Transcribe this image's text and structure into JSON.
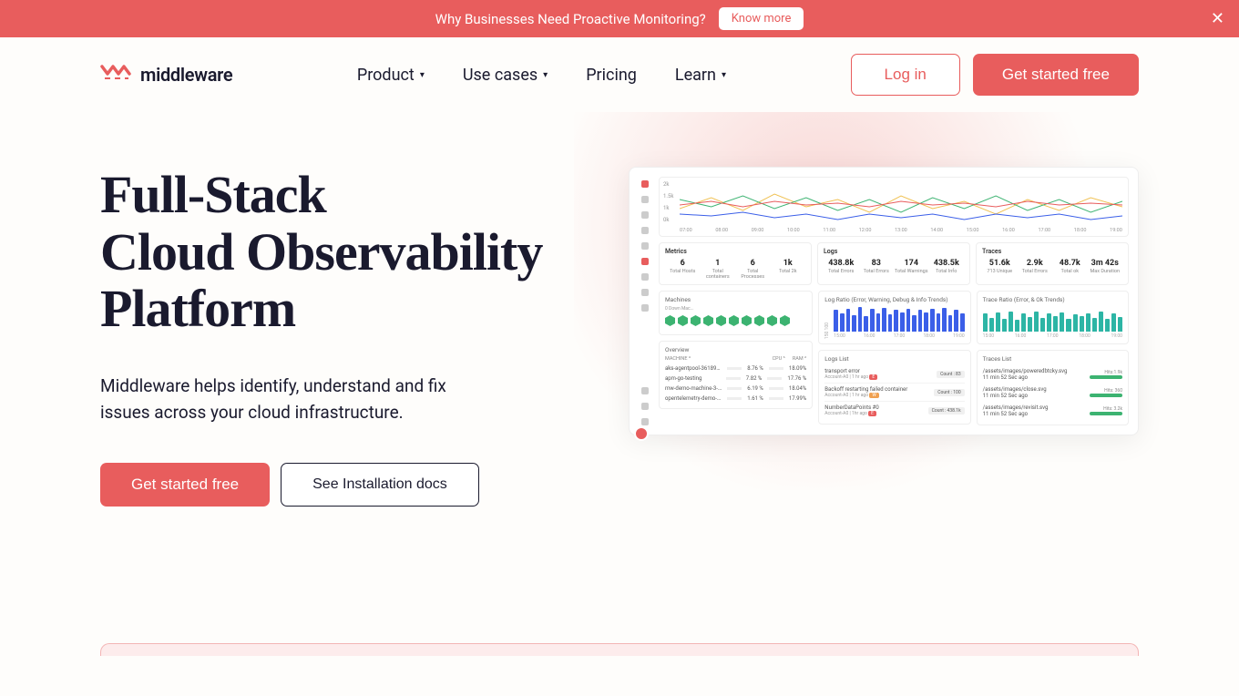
{
  "banner": {
    "text": "Why Businesses Need Proactive Monitoring?",
    "cta": "Know more"
  },
  "brand": {
    "name": "middleware"
  },
  "nav": {
    "product": "Product",
    "use_cases": "Use cases",
    "pricing": "Pricing",
    "learn": "Learn"
  },
  "header_actions": {
    "login": "Log in",
    "get_started": "Get started free"
  },
  "hero": {
    "title_l1": "Full-Stack",
    "title_l2": "Cloud Observability",
    "title_l3": "Platform",
    "desc": "Middleware helps identify, understand and fix issues across your cloud infrastructure.",
    "cta_primary": "Get started free",
    "cta_secondary": "See Installation docs"
  },
  "dashboard": {
    "line_chart": {
      "y_ticks": [
        "2k",
        "1.5k",
        "1k",
        "0k"
      ],
      "x_ticks": [
        "07:00",
        "08:00",
        "09:00",
        "10:00",
        "11:00",
        "12:00",
        "13:00",
        "14:00",
        "15:00",
        "16:00",
        "17:00",
        "18:00",
        "19:00"
      ]
    },
    "metrics": {
      "title": "Metrics",
      "items": [
        {
          "v": "6",
          "l": "Total Hosts"
        },
        {
          "v": "1",
          "l": "Total containers"
        },
        {
          "v": "6",
          "l": "Total Processes"
        },
        {
          "v": "1k",
          "l": "Total 2k"
        }
      ]
    },
    "logs": {
      "title": "Logs",
      "items": [
        {
          "v": "438.8k",
          "l": "Total Errors"
        },
        {
          "v": "83",
          "l": "Total Errors"
        },
        {
          "v": "174",
          "l": "Total Warnings"
        },
        {
          "v": "438.5k",
          "l": "Total Info"
        }
      ]
    },
    "traces": {
      "title": "Traces",
      "items": [
        {
          "v": "51.6k",
          "l": "713 Unique"
        },
        {
          "v": "2.9k",
          "l": "Total Errors"
        },
        {
          "v": "48.7k",
          "l": "Total ok"
        },
        {
          "v": "3m 42s",
          "l": "Max Duration"
        }
      ]
    },
    "machines": {
      "title": "Machines",
      "subtitle": "0 Down Mac...",
      "count": 10
    },
    "log_ratio": {
      "title": "Log Ratio (Error, Warning, Debug & Info Trends)",
      "y": "150  100",
      "x_ticks": [
        "15:00",
        "16:00",
        "17:00",
        "18:00",
        "19:00"
      ]
    },
    "trace_ratio": {
      "title": "Trace Ratio (Error, & Ok Trends)",
      "x_ticks": [
        "15:00",
        "16:00",
        "17:00",
        "18:00",
        "19:00"
      ]
    },
    "overview": {
      "title": "Overview",
      "cols": [
        "MACHINE ^",
        "CPU ^",
        "RAM ^"
      ],
      "rows": [
        {
          "name": "aks-agentpool-36189318-",
          "cpu": "8.76 %",
          "ram": "18.09%"
        },
        {
          "name": "apm-go-testing",
          "cpu": "7.82 %",
          "ram": "17.76 %"
        },
        {
          "name": "mw-demo-machine-3-166",
          "cpu": "6.19 %",
          "ram": "18.04%"
        },
        {
          "name": "opentelemetry-demo-ftsp",
          "cpu": "1.61 %",
          "ram": "17.99%"
        }
      ]
    },
    "logs_list": {
      "title": "Logs List",
      "rows": [
        {
          "t": "transport error",
          "sub": "Account-A0  |  1 hr ago",
          "badge": "E",
          "count": "Count : 83"
        },
        {
          "t": "Backoff restarting failed container",
          "sub": "Account-A0  |  1 hr ago",
          "badge": "W",
          "count": "Count : 100"
        },
        {
          "t": "NumberDataPoints #0",
          "sub": "Account-A0  |  1hr ago",
          "badge": "E",
          "count": "Count : 438.1k"
        }
      ]
    },
    "traces_list": {
      "title": "Traces List",
      "rows": [
        {
          "t": "/assets/images/poweredbtcky.svg",
          "sub": "11 min 52 Sec ago",
          "hits": "Hits:1.9k"
        },
        {
          "t": "/assets/images/close.svg",
          "sub": "11 min 52 Sec ago",
          "hits": "Hits: 360"
        },
        {
          "t": "/assets/images/revisit.svg",
          "sub": "11 min 52 Sec ago",
          "hits": "Hits: 3.2k"
        }
      ]
    }
  }
}
